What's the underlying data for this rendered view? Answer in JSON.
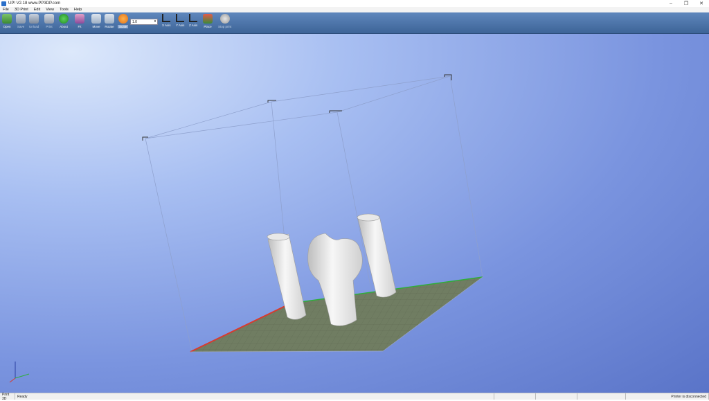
{
  "window": {
    "title": "UP!  V2.18 www.PP3DP.com",
    "minimize": "–",
    "maximize": "❐",
    "close": "✕"
  },
  "menu": [
    "File",
    "3D Print",
    "Edit",
    "View",
    "Tools",
    "Help"
  ],
  "toolbar": {
    "open": "Open",
    "save": "Save",
    "unload": "Unload",
    "print": "Print",
    "about": "About",
    "fit": "Fit",
    "move": "Move",
    "rotate": "Rotate",
    "scale": "Scale",
    "scale_value": "1.0",
    "x_axis": "X Axis",
    "y_axis": "Y Axis",
    "z_axis": "Z Axis",
    "place": "Place",
    "stop_print": "Stop print"
  },
  "status": {
    "left": "Print 3D",
    "message": "Ready",
    "printer": "Printer is disconnected"
  },
  "colors": {
    "accent": "#3d6497",
    "platform": "#6e7a5f",
    "x_axis_edge": "#d83a2e",
    "y_axis_edge": "#2fae3a",
    "model": "#f2f2f2"
  }
}
